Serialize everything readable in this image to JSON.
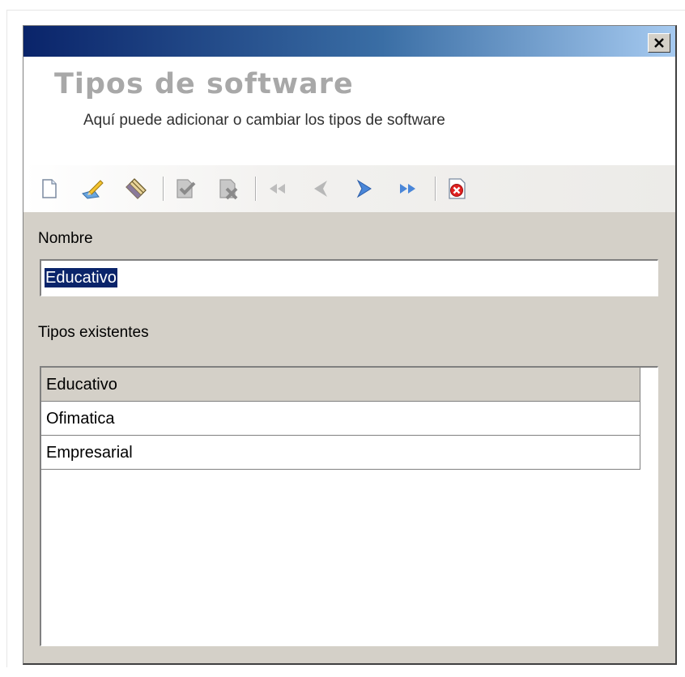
{
  "window": {
    "title": "Tipos de software",
    "subtitle": "Aquí puede adicionar o cambiar los tipos de software"
  },
  "toolbar": {
    "buttons": [
      {
        "icon": "new-document-icon",
        "enabled": true
      },
      {
        "icon": "edit-pencil-icon",
        "enabled": true
      },
      {
        "icon": "eraser-icon",
        "enabled": true
      },
      {
        "icon": "save-check-icon",
        "enabled": false
      },
      {
        "icon": "cancel-x-icon",
        "enabled": false
      },
      {
        "icon": "first-record-icon",
        "enabled": false
      },
      {
        "icon": "previous-record-icon",
        "enabled": false
      },
      {
        "icon": "next-record-icon",
        "enabled": true
      },
      {
        "icon": "last-record-icon",
        "enabled": true
      },
      {
        "icon": "close-form-icon",
        "enabled": true
      }
    ]
  },
  "form": {
    "nombre_label": "Nombre",
    "nombre_value": "Educativo"
  },
  "list": {
    "label": "Tipos existentes",
    "items": [
      "Educativo",
      "Ofimatica",
      "Empresarial"
    ],
    "selected_index": 0
  },
  "colors": {
    "titlebar_start": "#0a246a",
    "titlebar_end": "#a6caf0",
    "window_bg": "#d4d0c8",
    "selection": "#0a246a"
  }
}
